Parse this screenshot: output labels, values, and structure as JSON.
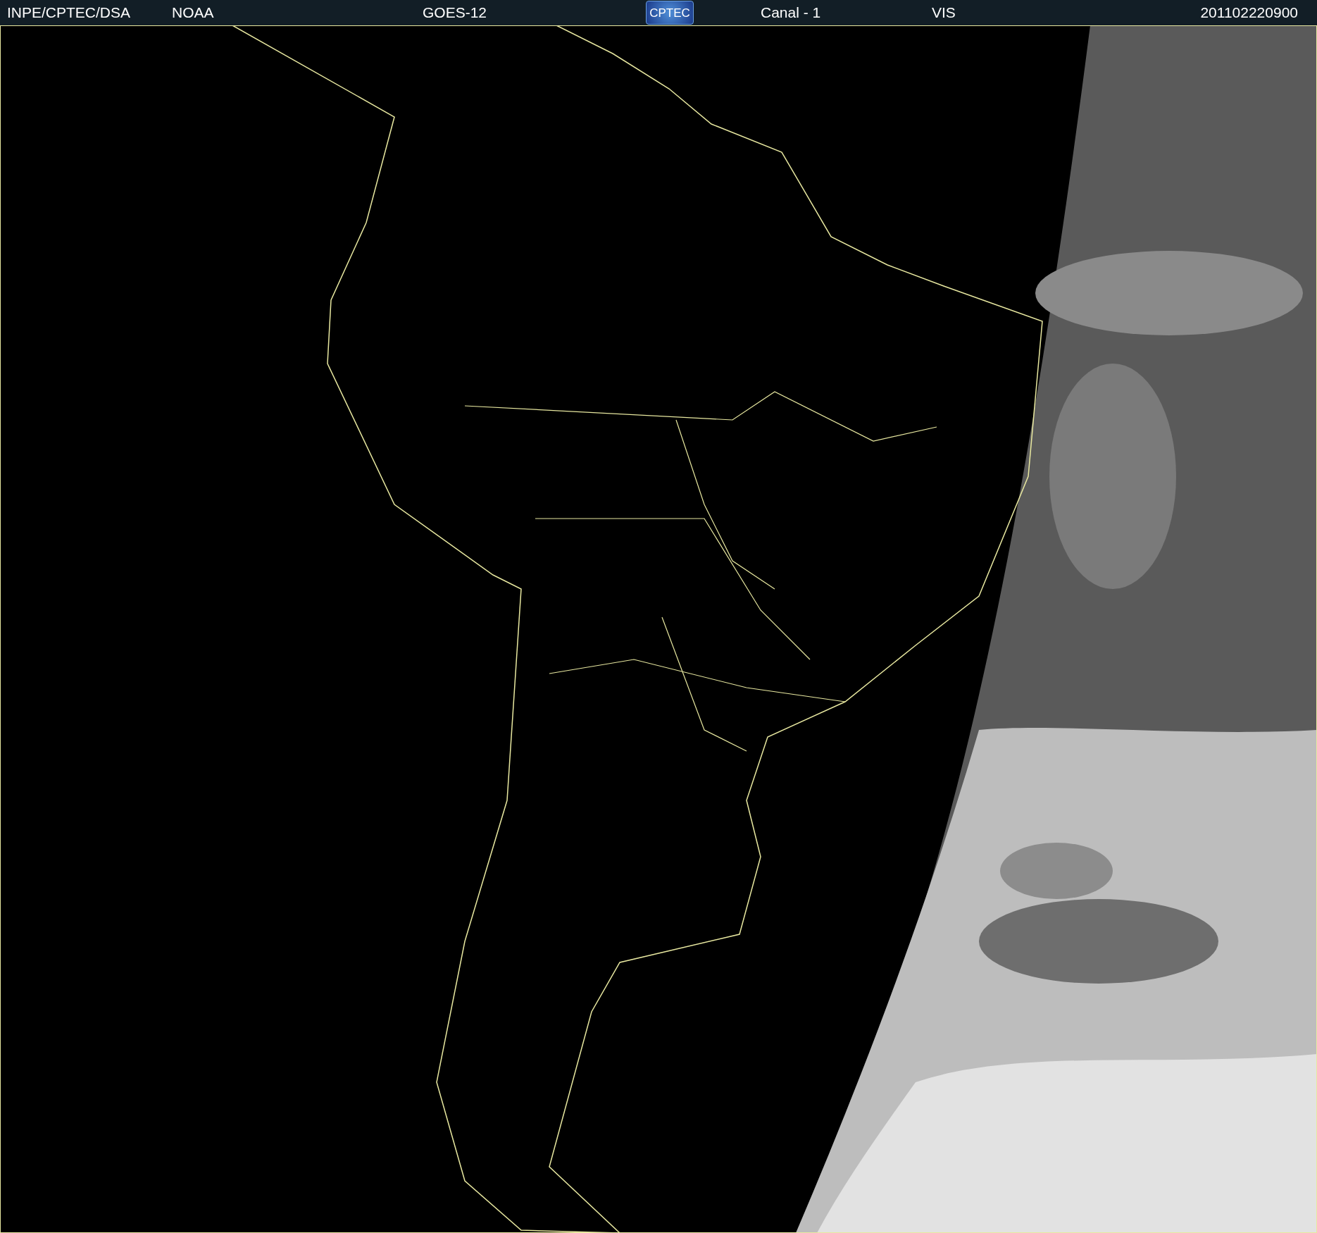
{
  "header": {
    "items": [
      {
        "kind": "text",
        "text": "INPE/CPTEC/DSA"
      },
      {
        "kind": "text",
        "text": "NOAA"
      },
      {
        "kind": "text",
        "text": "GOES-12"
      },
      {
        "kind": "logo",
        "text": "CPTEC"
      },
      {
        "kind": "text",
        "text": "Canal - 1"
      },
      {
        "kind": "text",
        "text": "VIS"
      },
      {
        "kind": "text",
        "text": "201102220900"
      }
    ]
  }
}
